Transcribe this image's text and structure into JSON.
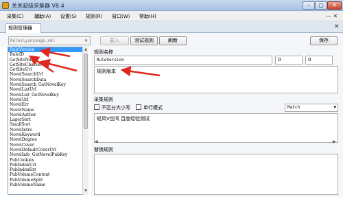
{
  "window": {
    "title": "关关超级采集器 V8.4",
    "min": "–",
    "max": "▢",
    "close": "✕"
  },
  "menu": {
    "items": [
      "采集(C)",
      "辅助(A)",
      "设置(S)",
      "规则(R)",
      "窗口(W)",
      "帮助(H)"
    ],
    "extra": "— ✕"
  },
  "tab": {
    "label": "规则管理器",
    "close": "✕"
  },
  "toolbar": {
    "combo_value": "Rules\\yunyaoge.xml",
    "load_label": "载入",
    "test_label": "测试规则",
    "refresh_label": "刷新",
    "save_label": "保存"
  },
  "rules": [
    "RuleVersion",
    "RuleID",
    "GetSiteName",
    "GetSiteCharset",
    "GetSiteUrl",
    "NovelSearchUrl",
    "NovelSearchData",
    "NovelSearch_GetNovelKey",
    "NovelListUrl",
    "NovelList_GetNovelKey",
    "NovelUrl",
    "NovelErr",
    "NovelName",
    "NovelAuthor",
    "LagerSort",
    "SmallSort",
    "NovelIntro",
    "NovelKeyword",
    "NovelDegree",
    "NovelCover",
    "NovelDefaultCoverUrl",
    "NovelInfo_GetNovelPubKey",
    "PubCookies",
    "PubIndexUrl",
    "PubIndexErr",
    "PubVolumeContent",
    "PubVolumeSplit",
    "PubVolumeName"
  ],
  "selected_rule": 0,
  "editor": {
    "name_label": "规则名称",
    "name_value": "RuleVersion",
    "num1": "0",
    "num2": "0",
    "desc_text": "规则版本",
    "collect_label": "采集规则",
    "ignore_case_label": "不区分大小写",
    "single_line_label": "单行模式",
    "match_mode": "Match",
    "rule_text": "轻风V空间  百度经验测试",
    "replace_label": "替换规则"
  },
  "colors": {
    "selection": "#3399ff",
    "arrow": "#e0281e"
  }
}
